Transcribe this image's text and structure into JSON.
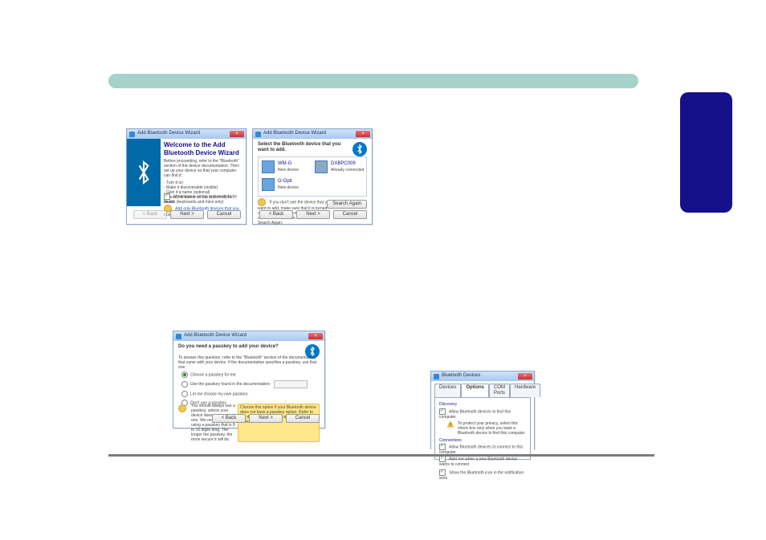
{
  "wizard1": {
    "title": "Add Bluetooth Device Wizard",
    "heading": "Welcome to the Add Bluetooth Device Wizard",
    "intro": "Before proceeding, refer to the \"Bluetooth\" section of the device documentation. Then set up your device so that your computer can find it:",
    "bullets": "- Turn it on\n- Make it discoverable (visible)\n- Give it a name (optional)\n- Press the button on the bottom of the device (keyboards and mice only)",
    "checkbox": "My device is set up and ready to be found.",
    "tip": "Add only Bluetooth devices that you trust.",
    "back": "< Back",
    "next": "Next >",
    "cancel": "Cancel"
  },
  "wizard2": {
    "title": "Add Bluetooth Device Wizard",
    "heading": "Select the Bluetooth device that you want to add.",
    "dev1_name": "WM-G",
    "dev1_sub": "New device",
    "dev2_name": "DXBPC009",
    "dev2_sub": "Already connected",
    "dev3_name": "G-Opti",
    "dev3_sub": "New device",
    "note": "If you don't see the device that you want to add, make sure that it is turned on. Follow the setup instructions that came with the device, and then click Search Again.",
    "search_again": "Search Again",
    "back": "< Back",
    "next": "Next >",
    "cancel": "Cancel"
  },
  "wizard3": {
    "title": "Add Bluetooth Device Wizard",
    "heading": "Do you need a passkey to add your device?",
    "intro": "To answer this question, refer to the \"Bluetooth\" section of the documentation that came with your device. If the documentation specifies a passkey, use that one.",
    "opt1": "Choose a passkey for me",
    "opt2": "Use the passkey found in the documentation:",
    "opt3": "Let me choose my own passkey:",
    "opt4": "Don't use a passkey",
    "hint_label": "You should always use a passkey, unless your device does not support one. We recommend using a passkey that is 8 to 16 digits long. The longer the passkey, the more secure it will be.",
    "hint_highlight": "Choose this option if your Bluetooth device does not have a passkey option. Refer to the documentation that came with the device.",
    "back": "< Back",
    "next": "Next >",
    "cancel": "Cancel"
  },
  "btwin": {
    "title": "Bluetooth Devices",
    "tabs": {
      "devices": "Devices",
      "options": "Options",
      "com": "COM Ports",
      "hardware": "Hardware"
    },
    "section": "Discovery",
    "chk_allow_find": "Allow Bluetooth devices to find this computer",
    "warn": "To protect your privacy, select this check box only when you want a Bluetooth device to find this computer.",
    "section2": "Connections",
    "chk_allow_connect": "Allow Bluetooth devices to connect to this computer",
    "chk_alert": "Alert me when a new Bluetooth device wants to connect",
    "chk_show_icon": "Show the Bluetooth icon in the notification area"
  }
}
